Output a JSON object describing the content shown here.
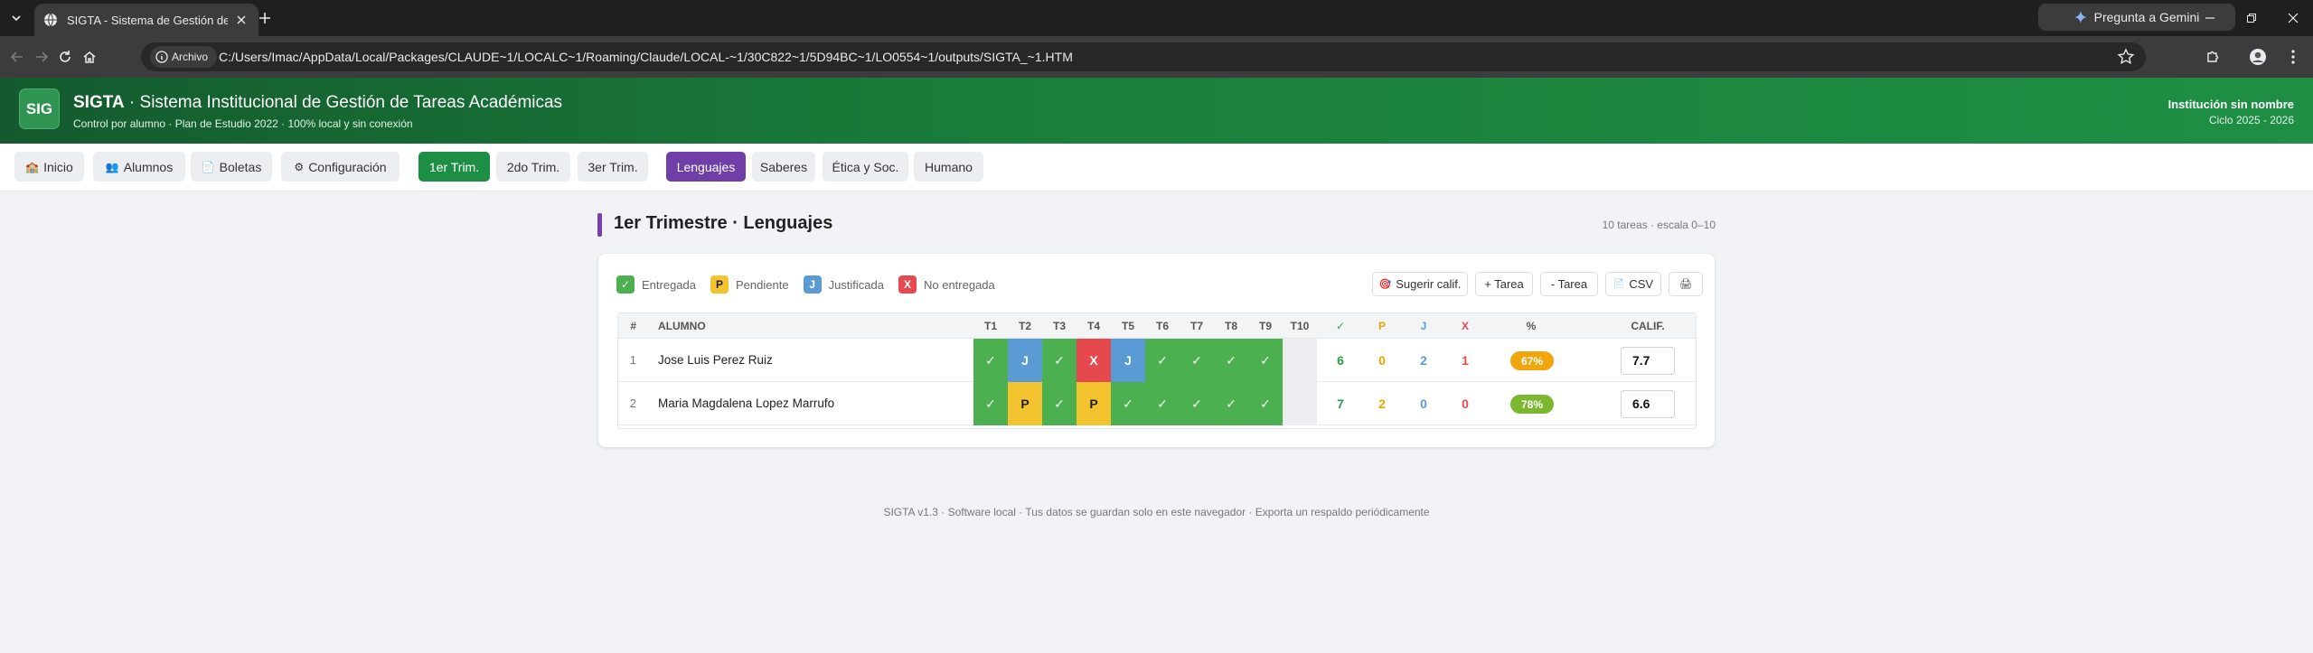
{
  "browser": {
    "tab_title": "SIGTA - Sistema de Gestión de T",
    "url": "C:/Users/Imac/AppData/Local/Packages/CLAUDE~1/LOCALC~1/Roaming/Claude/LOCAL-~1/30C822~1/5D94BC~1/LO0554~1/outputs/SIGTA_~1.HTM",
    "site_chip": "Archivo",
    "gemini_label": "Pregunta a Gemini"
  },
  "header": {
    "logo": "SIG",
    "title_bold": "SIGTA",
    "title_rest": " · Sistema Institucional de Gestión de Tareas Académicas",
    "subtitle": "Control por alumno · Plan de Estudio 2022 · 100% local y sin conexión",
    "institution": "Institución sin nombre",
    "cycle": "Ciclo 2025 - 2026"
  },
  "nav": {
    "inicio": "Inicio",
    "alumnos": "Alumnos",
    "boletas": "Boletas",
    "config": "Configuración",
    "trim1": "1er Trim.",
    "trim2": "2do Trim.",
    "trim3": "3er Trim.",
    "lenguajes": "Lenguajes",
    "saberes": "Saberes",
    "etica": "Ética y Soc.",
    "humano": "Humano"
  },
  "section": {
    "title": "1er Trimestre · Lenguajes",
    "meta": "10 tareas · escala 0–10"
  },
  "legend": {
    "entregada_icon": "✓",
    "entregada": "Entregada",
    "pendiente_icon": "P",
    "pendiente": "Pendiente",
    "justificada_icon": "J",
    "justificada": "Justificada",
    "noentregada_icon": "X",
    "noentregada": "No entregada"
  },
  "actions": {
    "sugerir": "Sugerir calif.",
    "add_tarea": "+ Tarea",
    "remove_tarea": "- Tarea",
    "csv": "CSV"
  },
  "colors": {
    "entregada": "#4caf50",
    "pendiente": "#f4c430",
    "justificada": "#5b9bd5",
    "noentregada": "#e5484d",
    "brand_green": "#1c8f45",
    "accent_purple": "#6f3ea6"
  },
  "table": {
    "headers": {
      "num": "#",
      "alumno": "ALUMNO",
      "tasks": [
        "T1",
        "T2",
        "T3",
        "T4",
        "T5",
        "T6",
        "T7",
        "T8",
        "T9",
        "T10"
      ],
      "c_ent": "✓",
      "c_pen": "P",
      "c_jus": "J",
      "c_no": "X",
      "pct": "%",
      "calif": "CALIF."
    },
    "rows": [
      {
        "num": "1",
        "name": "Jose Luis Perez Ruiz",
        "marks": [
          "✓",
          "J",
          "✓",
          "X",
          "J",
          "✓",
          "✓",
          "✓",
          "✓",
          ""
        ],
        "status": [
          "entregada",
          "justificada",
          "entregada",
          "noentregada",
          "justificada",
          "entregada",
          "entregada",
          "entregada",
          "entregada",
          "vacia"
        ],
        "c_ent": "6",
        "c_pen": "0",
        "c_jus": "2",
        "c_no": "1",
        "pct": "67%",
        "pct_color": "#f0a50c",
        "grade": "7.7"
      },
      {
        "num": "2",
        "name": "Maria Magdalena Lopez Marrufo",
        "marks": [
          "✓",
          "P",
          "✓",
          "P",
          "✓",
          "✓",
          "✓",
          "✓",
          "✓",
          ""
        ],
        "status": [
          "entregada",
          "pendiente",
          "entregada",
          "pendiente",
          "entregada",
          "entregada",
          "entregada",
          "entregada",
          "entregada",
          "vacia"
        ],
        "c_ent": "7",
        "c_pen": "2",
        "c_jus": "0",
        "c_no": "0",
        "pct": "78%",
        "pct_color": "#7cb82f",
        "grade": "6.6"
      }
    ]
  },
  "footer": "SIGTA v1.3 · Software local · Tus datos se guardan solo en este navegador · Exporta un respaldo periódicamente"
}
